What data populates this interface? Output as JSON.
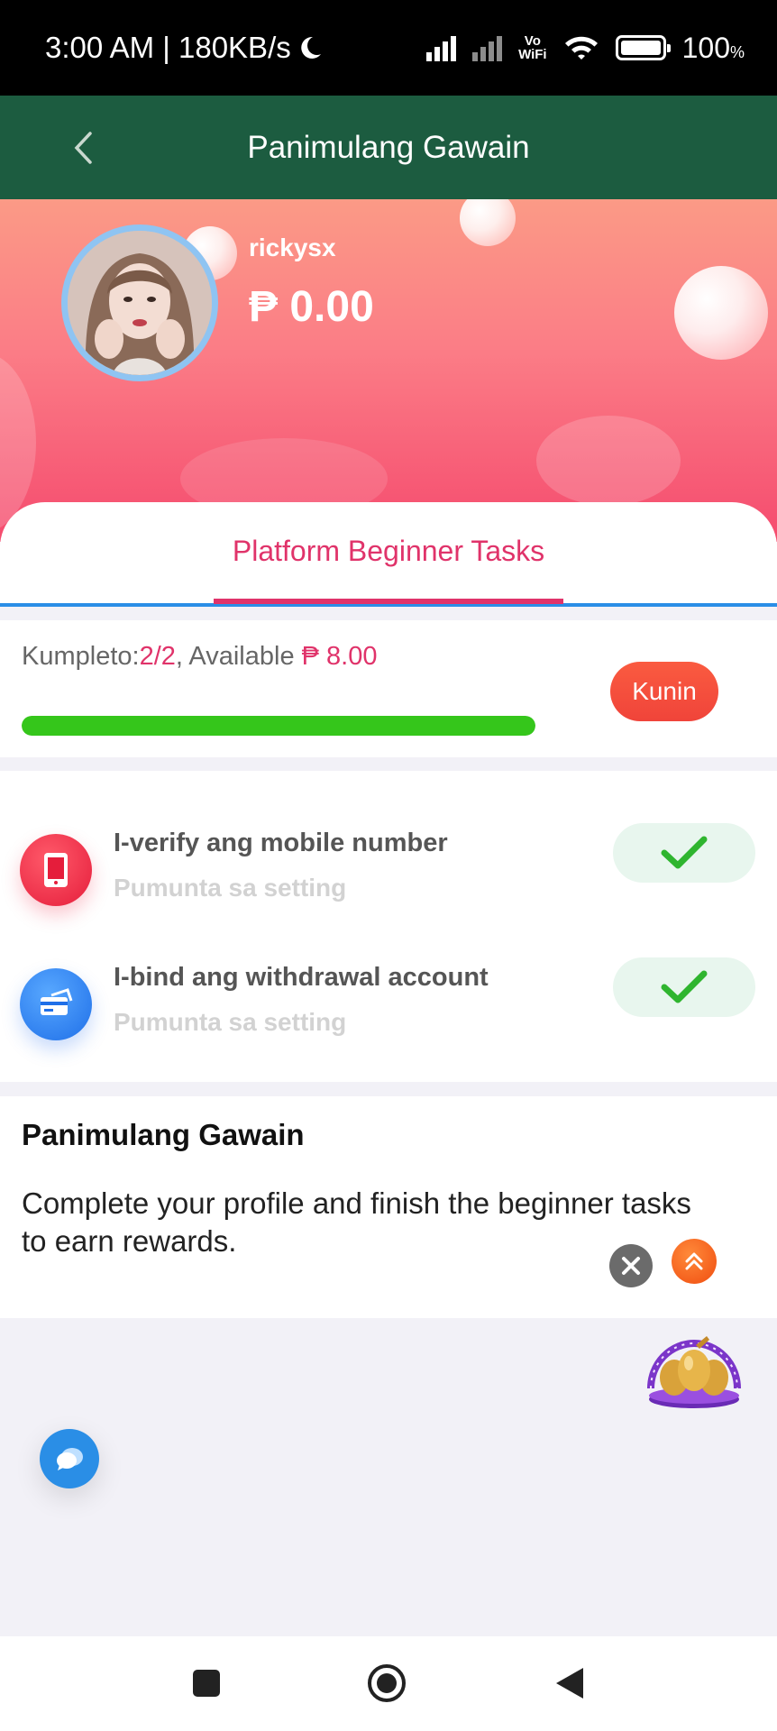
{
  "status_bar": {
    "time_speed": "3:00 AM | 180KB/s",
    "vowifi_top": "Vo",
    "vowifi_bottom": "WiFi",
    "battery_pct": "100",
    "battery_unit": "%"
  },
  "header": {
    "title": "Panimulang Gawain"
  },
  "profile": {
    "username": "rickysx",
    "balance": "₱ 0.00"
  },
  "tabs": [
    {
      "label": "Platform Beginner Tasks",
      "active": true
    }
  ],
  "progress": {
    "label_prefix": "Kumpleto:",
    "completed": "2/2",
    "available_label": ", Available ",
    "available_amount": "₱ 8.00",
    "fraction": 1.0,
    "claim_label": "Kunin"
  },
  "tasks": [
    {
      "title": "I-verify ang mobile number",
      "subtitle": "Pumunta sa setting",
      "done": true,
      "icon": "phone-icon"
    },
    {
      "title": "I-bind ang withdrawal account",
      "subtitle": "Pumunta sa setting",
      "done": true,
      "icon": "card-icon"
    }
  ],
  "description": {
    "title": "Panimulang Gawain",
    "text": "Complete your profile and finish the beginner tasks to earn rewards."
  },
  "colors": {
    "header_bg": "#1c5c40",
    "accent": "#e0336a",
    "progress": "#35c61b",
    "claim": "#f0443a",
    "tab_line": "#2a8ee6"
  }
}
